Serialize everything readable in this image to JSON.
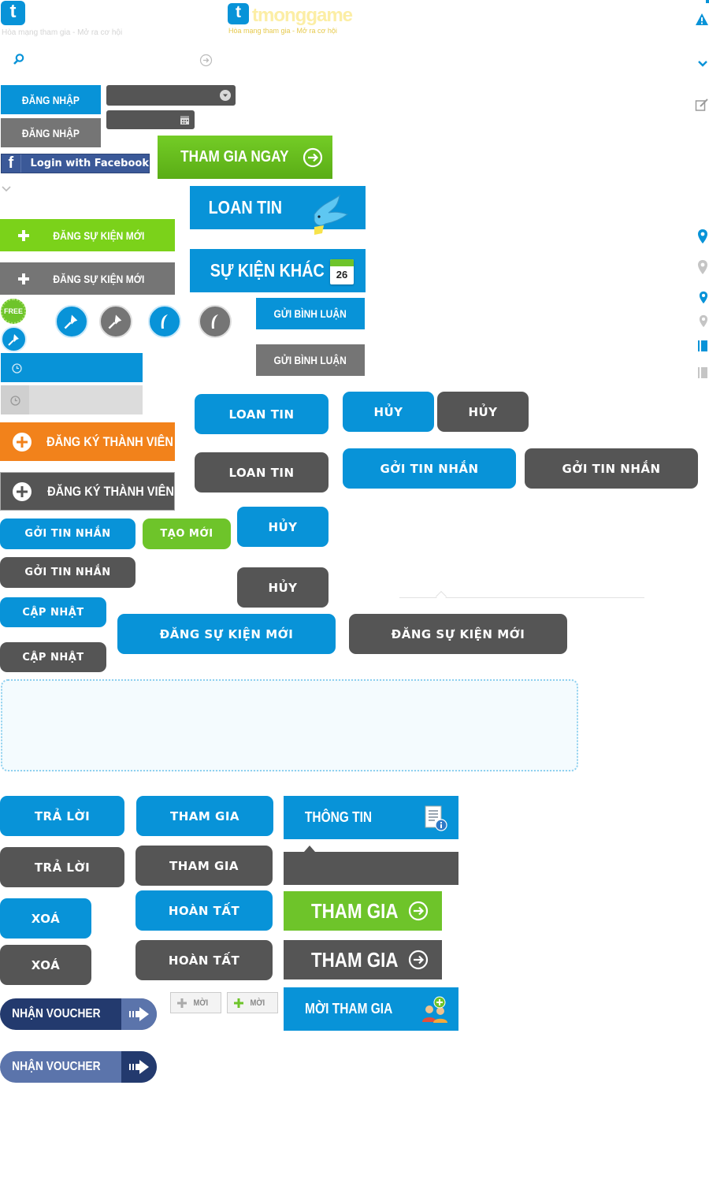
{
  "logo": {
    "letter": "t",
    "tagline": "Hòa mạng tham gia - Mở ra cơ hội",
    "wordmark": "tmonggame"
  },
  "colors": {
    "blue": "#0893d8",
    "gray": "#757575",
    "dark_gray": "#555555",
    "green": "#6ec42a",
    "orange": "#f2821b",
    "navy": "#233a6e",
    "facebook": "#3b5998"
  },
  "buttons": {
    "login_blue": "ĐĂNG NHẬP",
    "login_gray": "ĐĂNG NHẬP",
    "facebook": "Login with Facebook",
    "join_now": "THAM GIA NGAY",
    "loan_tin_banner": "LOAN TIN",
    "su_kien_khac": "SỰ KIỆN KHÁC",
    "calendar_day": "26",
    "post_event_green": "ĐĂNG SỰ KIỆN MỚI",
    "post_event_gray": "ĐĂNG SỰ KIỆN MỚI",
    "free_badge": "FREE",
    "send_comment_blue": "GỬI BÌNH LUẬN",
    "send_comment_gray": "GỬI BÌNH LUẬN",
    "register_orange": "ĐĂNG KÝ THÀNH VIÊN",
    "register_gray": "ĐĂNG KÝ THÀNH VIÊN",
    "loan_tin_blue": "LOAN TIN",
    "loan_tin_gray": "LOAN TIN",
    "cancel_blue": "HỦY",
    "cancel_gray": "HỦY",
    "send_msg_blue_wide": "GỞI TIN NHẮN",
    "send_msg_gray_wide": "GỞI TIN NHẮN",
    "send_msg_blue": "GỞI TIN NHẮN",
    "create_new": "TẠO MỚI",
    "cancel_blue_2": "HỦY",
    "send_msg_gray": "GỞI TIN NHẮN",
    "cancel_gray_2": "HỦY",
    "update_blue": "CẬP NHẬT",
    "update_gray": "CẬP NHẬT",
    "post_event_pill_blue": "ĐĂNG SỰ KIỆN MỚI",
    "post_event_pill_gray": "ĐĂNG SỰ KIỆN MỚI",
    "reply_blue": "TRẢ LỜI",
    "reply_gray": "TRẢ LỜI",
    "join_blue": "THAM GIA",
    "join_gray": "THAM GIA",
    "info": "THÔNG TIN",
    "delete_blue": "XOÁ",
    "delete_gray": "XOÁ",
    "done_blue": "HOÀN TẤT",
    "done_gray": "HOÀN TẤT",
    "join_green_big": "THAM GIA",
    "join_gray_big": "THAM GIA",
    "voucher_navy": "NHẬN VOUCHER",
    "voucher_light": "NHẬN VOUCHER",
    "new_gray": "MỜI",
    "new_green": "MỜI",
    "invite": "MỜI THAM GIA"
  }
}
